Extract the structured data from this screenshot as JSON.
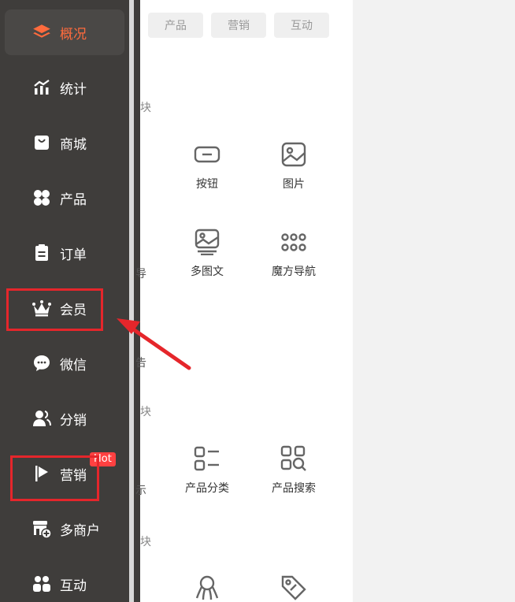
{
  "sidebar": {
    "items": [
      {
        "label": "概况",
        "icon": "layers-icon",
        "active": true
      },
      {
        "label": "统计",
        "icon": "chart-icon"
      },
      {
        "label": "商城",
        "icon": "shop-bag-icon"
      },
      {
        "label": "产品",
        "icon": "clover-icon"
      },
      {
        "label": "订单",
        "icon": "clipboard-icon"
      },
      {
        "label": "会员",
        "icon": "crown-icon"
      },
      {
        "label": "微信",
        "icon": "chat-bubble-icon"
      },
      {
        "label": "分销",
        "icon": "users-icon"
      },
      {
        "label": "营销",
        "icon": "flag-icon",
        "badge": "Hot"
      },
      {
        "label": "多商户",
        "icon": "store-add-icon"
      },
      {
        "label": "互动",
        "icon": "people-icon"
      }
    ]
  },
  "tabs": [
    "产品",
    "营销",
    "互动"
  ],
  "sections": {
    "fragment_1": "块",
    "fragment_2": "块",
    "fragment_3": "块"
  },
  "edge_fragments": {
    "row2": "导",
    "gap": "告",
    "row3": "示"
  },
  "components": {
    "button": "按钮",
    "image": "图片",
    "multi_image_text": "多图文",
    "cube_nav": "魔方导航",
    "category": "产品分类",
    "search": "产品搜索"
  },
  "colors": {
    "sidebar_bg": "#3f3d3b",
    "active_text": "#ff6b3d",
    "badge_bg": "#ff4141",
    "annotation": "#e5262b"
  }
}
